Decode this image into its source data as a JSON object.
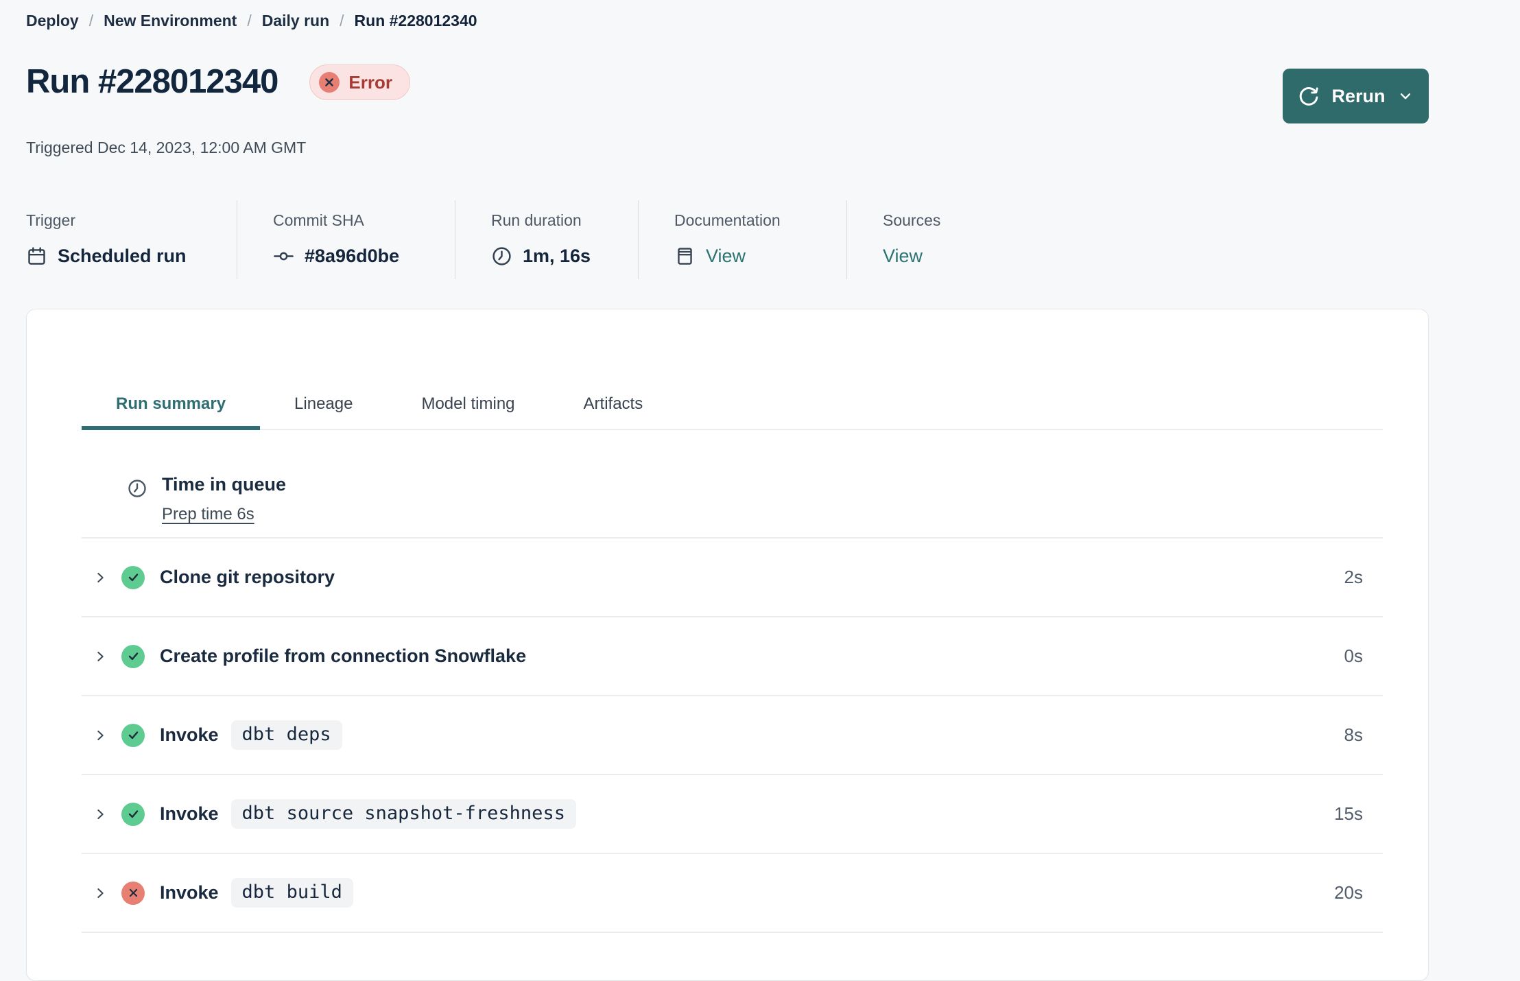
{
  "breadcrumb": {
    "separator": "/",
    "items": [
      "Deploy",
      "New Environment",
      "Daily run",
      "Run #228012340"
    ]
  },
  "header": {
    "title": "Run #228012340",
    "status_badge": "Error",
    "triggered": "Triggered Dec 14, 2023, 12:00 AM GMT",
    "rerun_label": "Rerun"
  },
  "meta": {
    "columns": [
      {
        "label": "Trigger",
        "value": "Scheduled run",
        "icon": "calendar-icon"
      },
      {
        "label": "Commit SHA",
        "value": "#8a96d0be",
        "icon": "commit-icon"
      },
      {
        "label": "Run duration",
        "value": "1m, 16s",
        "icon": "clock-icon"
      },
      {
        "label": "Documentation",
        "value": "View",
        "icon": "document-icon"
      },
      {
        "label": "Sources",
        "value": "View"
      }
    ]
  },
  "tabs": [
    {
      "label": "Run summary",
      "active": true
    },
    {
      "label": "Lineage",
      "active": false
    },
    {
      "label": "Model timing",
      "active": false
    },
    {
      "label": "Artifacts",
      "active": false
    }
  ],
  "queue": {
    "title": "Time in queue",
    "link": "Prep time 6s"
  },
  "steps": [
    {
      "title": "Clone git repository",
      "status": "success",
      "duration": "2s"
    },
    {
      "title": "Create profile from connection Snowflake",
      "status": "success",
      "duration": "0s"
    },
    {
      "title": "Invoke",
      "command": "dbt deps",
      "status": "success",
      "duration": "8s"
    },
    {
      "title": "Invoke",
      "command": "dbt source snapshot-freshness",
      "status": "success",
      "duration": "15s"
    },
    {
      "title": "Invoke",
      "command": "dbt build",
      "status": "error",
      "duration": "20s"
    }
  ],
  "colors": {
    "accent_teal": "#2e6b6a",
    "active_tab_teal": "#2f6e72",
    "link_teal": "#2b7472",
    "success_green": "#5ecb91",
    "error_salmon": "#e87f73",
    "error_badge_bg": "#fae3e2",
    "error_text": "#a63c34",
    "page_bg": "#f7f8fa",
    "card_bg": "#ffffff",
    "heading_navy": "#12263e"
  }
}
